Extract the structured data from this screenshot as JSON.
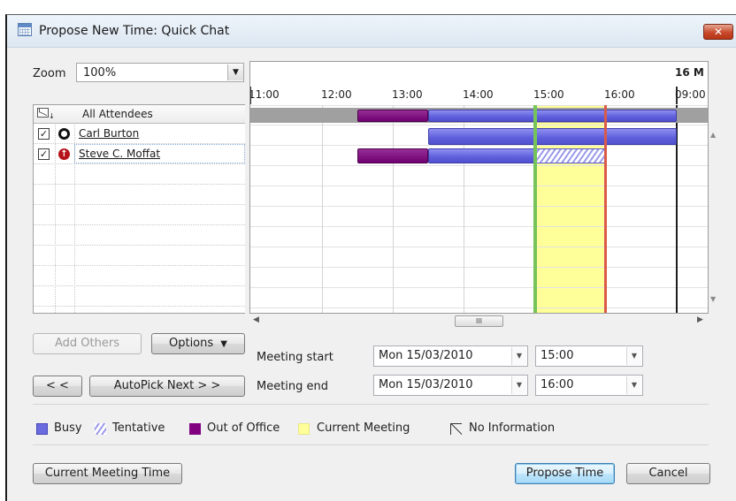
{
  "dialog": {
    "title": "Propose New Time:  Quick Chat",
    "close_glyph": "✕"
  },
  "zoom": {
    "label": "Zoom",
    "value": "100%"
  },
  "attendees": {
    "header": "All Attendees",
    "rows": [
      {
        "name": "Carl Burton",
        "checked": true,
        "icon": "organizer-icon"
      },
      {
        "name": "Steve C. Moffat",
        "checked": true,
        "icon": "required-attendee-icon"
      }
    ]
  },
  "timeline": {
    "date_label": "16 M",
    "times": [
      "11:00",
      "12:00",
      "13:00",
      "14:00",
      "15:00",
      "16:00",
      "09:00"
    ]
  },
  "buttons": {
    "add_others": "Add Others",
    "options": "Options",
    "prev": "< <",
    "autopick": "AutoPick Next > >",
    "current_meeting_time": "Current Meeting Time",
    "propose_time": "Propose Time",
    "cancel": "Cancel"
  },
  "meeting": {
    "start_label": "Meeting start",
    "end_label": "Meeting end",
    "start_date": "Mon 15/03/2010",
    "start_time": "15:00",
    "end_date": "Mon 15/03/2010",
    "end_time": "16:00"
  },
  "legend": {
    "busy": "Busy",
    "tentative": "Tentative",
    "out_of_office": "Out of Office",
    "current_meeting": "Current Meeting",
    "no_information": "No Information"
  },
  "colors": {
    "busy": "#5e5edb",
    "out_of_office": "#700070",
    "current_meeting": "#ffff99",
    "start_marker": "#75c45a",
    "end_marker": "#d95a4a"
  }
}
